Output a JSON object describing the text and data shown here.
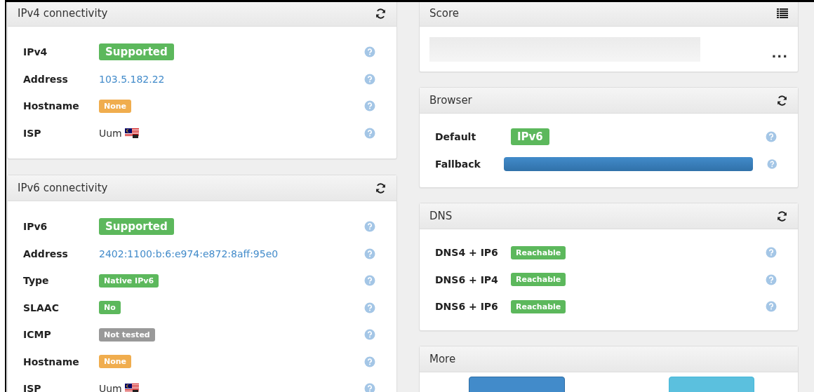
{
  "columns": [
    {
      "panels": [
        {
          "title": "IPv4 connectivity",
          "kind": "refresh",
          "rows": [
            {
              "label": "IPv4",
              "kind": "bigbadge",
              "value": "Supported",
              "color": "#5cb85c"
            },
            {
              "label": "Address",
              "kind": "link",
              "value": "103.5.182.22"
            },
            {
              "label": "Hostname",
              "kind": "badge",
              "value": "None",
              "color": "#f0ad4e"
            },
            {
              "label": "ISP",
              "kind": "flag",
              "value": "Uum"
            }
          ]
        },
        {
          "title": "IPv6 connectivity",
          "kind": "refresh",
          "rows": [
            {
              "label": "IPv6",
              "kind": "bigbadge",
              "value": "Supported",
              "color": "#5cb85c"
            },
            {
              "label": "Address",
              "kind": "link",
              "value": "2402:1100:b:6:e974:e872:8aff:95e0"
            },
            {
              "label": "Type",
              "kind": "badge",
              "value": "Native IPv6",
              "color": "#5cb85c"
            },
            {
              "label": "SLAAC",
              "kind": "badge",
              "value": "No",
              "color": "#5cb85c"
            },
            {
              "label": "ICMP",
              "kind": "badge",
              "value": "Not tested",
              "color": "#999999"
            },
            {
              "label": "Hostname",
              "kind": "badge",
              "value": "None",
              "color": "#f0ad4e"
            },
            {
              "label": "ISP",
              "kind": "flag",
              "value": "Uum"
            }
          ]
        }
      ]
    },
    {
      "panels": [
        {
          "title": "Score",
          "kind": "score",
          "more": "..."
        },
        {
          "title": "Browser",
          "kind": "refresh",
          "rows": [
            {
              "label": "Default",
              "kind": "bigbadge",
              "value": "IPv6",
              "color": "#5cb85c"
            },
            {
              "label": "Fallback",
              "kind": "bar",
              "level": 1
            }
          ]
        },
        {
          "title": "DNS",
          "kind": "refresh",
          "rows": [
            {
              "label": "DNS4 + IP6",
              "kind": "badge",
              "value": "Reachable",
              "color": "#5cb85c"
            },
            {
              "label": "DNS6 + IP4",
              "kind": "badge",
              "value": "Reachable",
              "color": "#5cb85c"
            },
            {
              "label": "DNS6 + IP6",
              "kind": "badge",
              "value": "Reachable",
              "color": "#5cb85c"
            }
          ]
        },
        {
          "title": "More",
          "kind": "buttons"
        }
      ]
    }
  ]
}
